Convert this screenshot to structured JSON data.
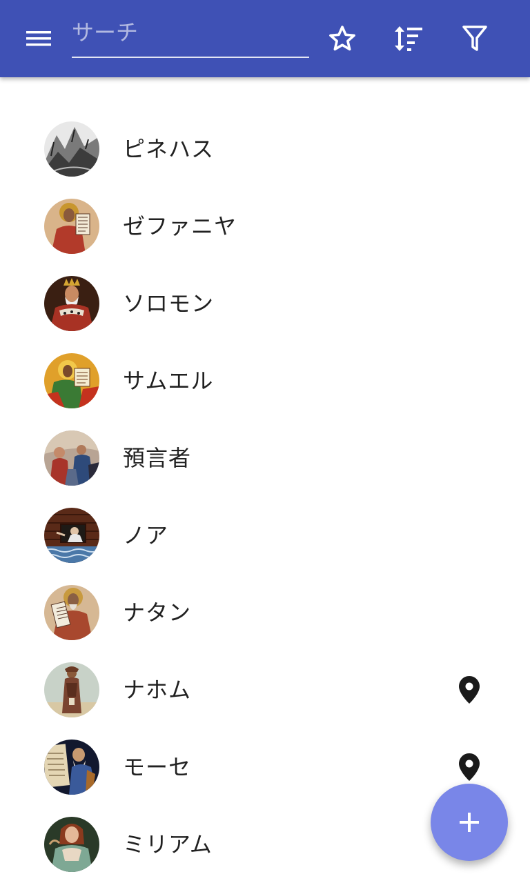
{
  "toolbar": {
    "background": "#3f51b5",
    "menu_icon": "hamburger-menu-icon",
    "search": {
      "placeholder": "サーチ",
      "value": ""
    },
    "actions": [
      "star-icon",
      "sort-icon",
      "filter-icon"
    ]
  },
  "list": {
    "items": [
      {
        "label": "ピネハス",
        "avatar": "engraving-portrait",
        "pin": false
      },
      {
        "label": "ゼファニヤ",
        "avatar": "icon-prophet-scroll",
        "pin": false
      },
      {
        "label": "ソロモン",
        "avatar": "king-portrait",
        "pin": false
      },
      {
        "label": "サムエル",
        "avatar": "icon-prophet-gold",
        "pin": false
      },
      {
        "label": "預言者",
        "avatar": "painting-crowd",
        "pin": false
      },
      {
        "label": "ノア",
        "avatar": "ark-window",
        "pin": false
      },
      {
        "label": "ナタン",
        "avatar": "icon-prophet-scroll-2",
        "pin": false
      },
      {
        "label": "ナホム",
        "avatar": "prophet-figure",
        "pin": true
      },
      {
        "label": "モーセ",
        "avatar": "moses-tablets",
        "pin": true
      },
      {
        "label": "ミリアム",
        "avatar": "woman-portrait",
        "pin": false
      }
    ]
  },
  "fab": {
    "icon": "add-icon",
    "color": "#7986e8"
  },
  "colors": {
    "accent": "#3f51b5",
    "text": "#212121",
    "pin": "#1a1a1a"
  }
}
